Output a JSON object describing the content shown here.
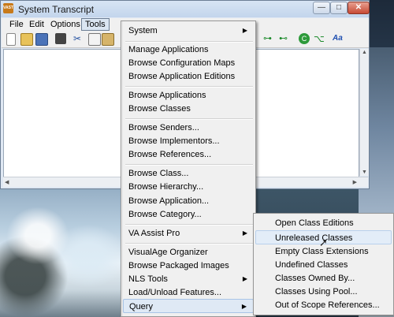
{
  "window": {
    "title": "System Transcript",
    "app_icon_label": "VAST",
    "controls": {
      "minimize": "—",
      "maximize": "□",
      "close": "✕"
    }
  },
  "menubar": {
    "file": "File",
    "edit": "Edit",
    "options": "Options",
    "tools": "Tools"
  },
  "toolbar_icons": [
    "new-icon",
    "open-icon",
    "save-icon",
    "print-icon",
    "cut-icon",
    "copy-icon",
    "paste-icon",
    "hierarchy-icon",
    "tree-icon",
    "refresh-icon",
    "branch-icon",
    "font-icon"
  ],
  "tools_menu": {
    "groups": [
      [
        "System"
      ],
      [
        "Manage Applications",
        "Browse Configuration Maps",
        "Browse Application Editions"
      ],
      [
        "Browse Applications",
        "Browse Classes"
      ],
      [
        "Browse Senders...",
        "Browse Implementors...",
        "Browse References..."
      ],
      [
        "Browse Class...",
        "Browse Hierarchy...",
        "Browse Application...",
        "Browse Category..."
      ],
      [
        "VA Assist Pro"
      ],
      [
        "VisualAge Organizer",
        "Browse Packaged Images",
        "NLS Tools",
        "Load/Unload Features...",
        "Query"
      ]
    ],
    "submenu_items": [
      "System",
      "VA Assist Pro",
      "NLS Tools",
      "Query"
    ],
    "active_item": "Query",
    "submenu_arrow": "▶"
  },
  "query_menu": {
    "items": [
      "Open Class Editions",
      "Unreleased Classes",
      "Empty Class Extensions",
      "Undefined Classes",
      "Classes Owned By...",
      "Classes Using Pool...",
      "Out of Scope References..."
    ],
    "hovered": "Unreleased Classes"
  },
  "font_icon_text": "Aa",
  "colors": {
    "accent_highlight": "#dfe9f5",
    "close_button": "#c74a35",
    "menu_bg": "#f0f0f0"
  }
}
